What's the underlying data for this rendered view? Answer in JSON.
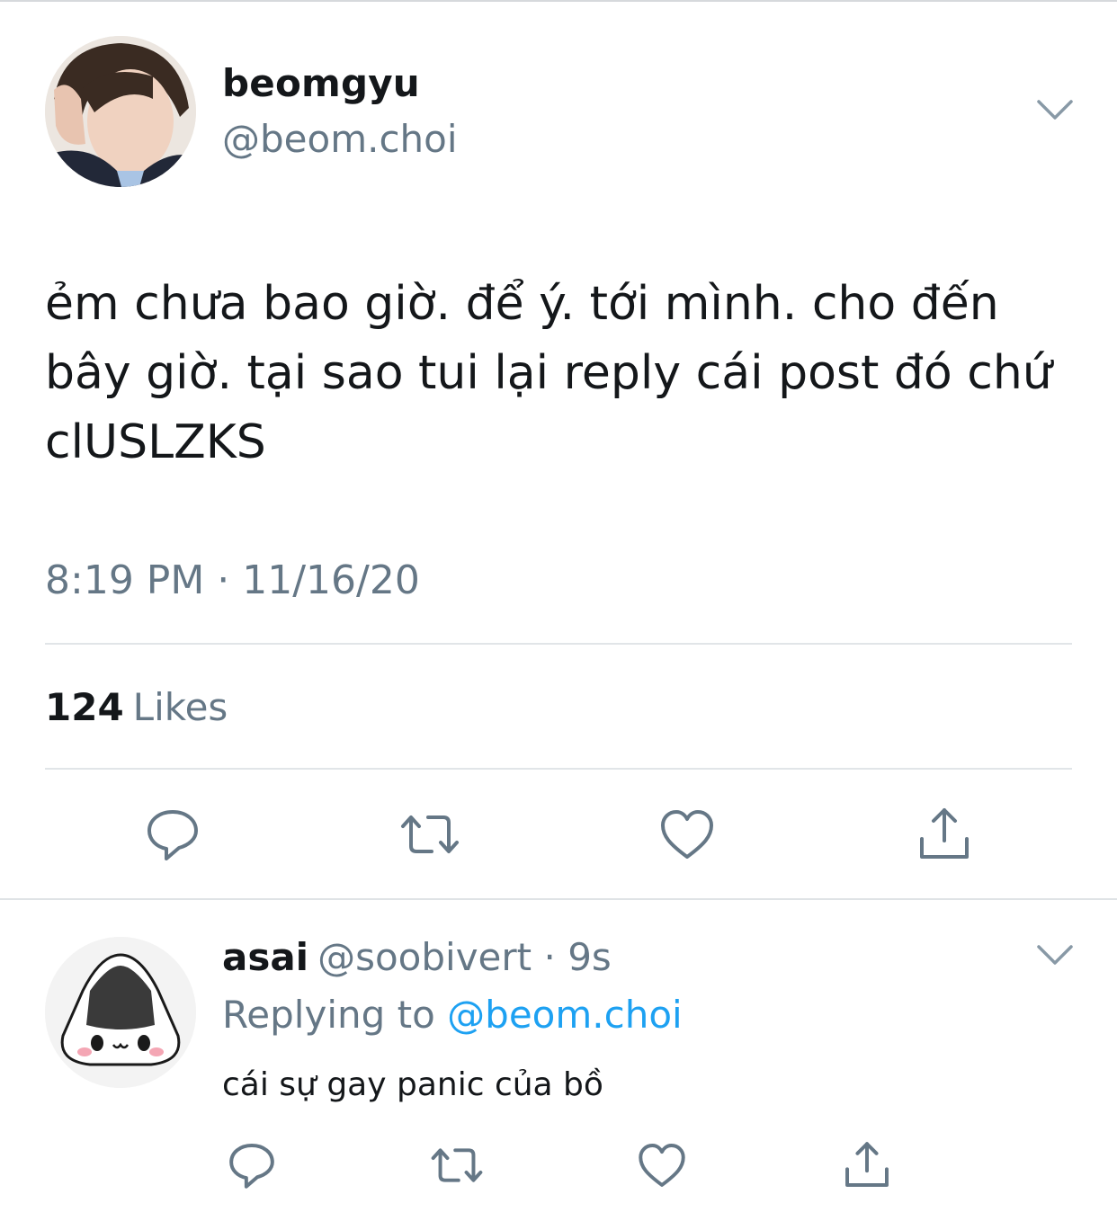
{
  "tweet": {
    "display_name": "beomgyu",
    "handle": "@beom.choi",
    "text": "ẻm chưa bao giờ. để ý. tới mình. cho đến\nbây giờ. tại sao tui lại reply cái post đó chứ\nclUSLZKS",
    "timestamp": "8:19 PM · 11/16/20",
    "likes_count": "124",
    "likes_label": "Likes",
    "actions": [
      "reply-icon",
      "retweet-icon",
      "like-icon",
      "share-icon"
    ]
  },
  "reply": {
    "display_name": "asai",
    "handle": "@soobivert",
    "time_separator": " · ",
    "time": "9s",
    "replying_to_label": "Replying to",
    "replying_to_handle": "@beom.choi",
    "text": "cái sự gay panic của bồ",
    "actions": [
      "reply-icon",
      "retweet-icon",
      "like-icon",
      "share-icon"
    ]
  },
  "colors": {
    "text_primary": "#14171a",
    "text_secondary": "#657786",
    "link": "#1da1f2",
    "icon": "#657786",
    "divider": "#e1e5e8"
  }
}
